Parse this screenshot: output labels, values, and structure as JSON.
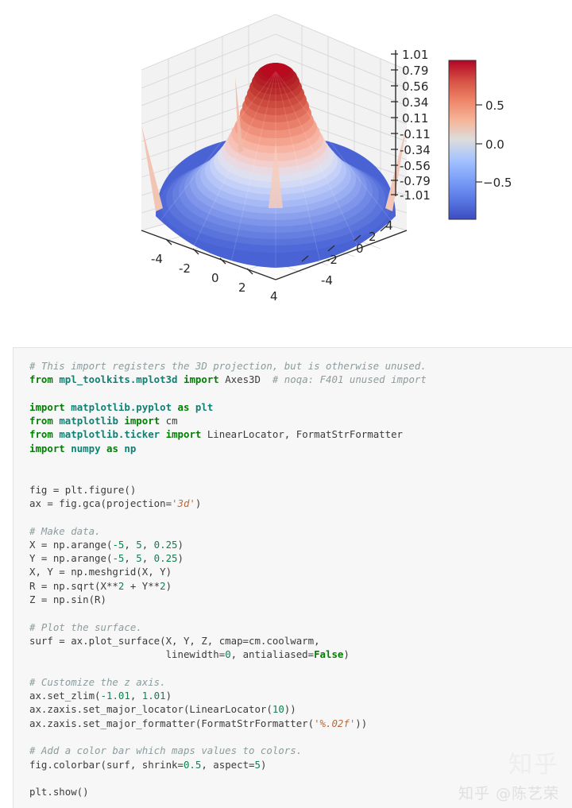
{
  "figure": {
    "plot_type": "surface3d",
    "colormap": "coolwarm",
    "z_axis": {
      "ticks": [
        "1.01",
        "0.79",
        "0.56",
        "0.34",
        "0.11",
        "-0.11",
        "-0.34",
        "-0.56",
        "-0.79",
        "-1.01"
      ],
      "lim": [
        -1.01,
        1.01
      ],
      "locator": "LinearLocator(10)",
      "formatter": "%.02f"
    },
    "x_axis": {
      "ticks": [
        "-4",
        "-2",
        "0",
        "2",
        "4"
      ],
      "lim": [
        -5,
        5
      ]
    },
    "y_axis": {
      "ticks": [
        "4",
        "2",
        "0",
        "-2",
        "-4"
      ],
      "lim": [
        -5,
        5
      ]
    },
    "colorbar": {
      "ticks": [
        "0.5",
        "0.0",
        "−0.5"
      ],
      "shrink": 0.5,
      "aspect": 5,
      "vmin": -1.0,
      "vmax": 1.0
    },
    "colors": {
      "cmap_low": "#3b4cc0",
      "cmap_mid": "#dddddd",
      "cmap_high": "#b40426",
      "pane": "#f2f2f2",
      "grid": "#d0d0d0",
      "axis": "#2b2b2b"
    }
  },
  "chart_data": {
    "type": "surface",
    "title": "",
    "xlabel": "",
    "ylabel": "",
    "zlabel": "",
    "function": "Z = sin(sqrt(X**2 + Y**2))",
    "x": {
      "start": -5,
      "stop": 5,
      "step": 0.25,
      "ticks": [
        -4,
        -2,
        0,
        2,
        4
      ]
    },
    "y": {
      "start": -5,
      "stop": 5,
      "step": 0.25,
      "ticks": [
        4,
        2,
        0,
        -2,
        -4
      ]
    },
    "z": {
      "min": -1.0,
      "max": 1.0,
      "lim": [
        -1.01,
        1.01
      ],
      "ticks": [
        1.01,
        0.79,
        0.56,
        0.34,
        0.11,
        -0.11,
        -0.34,
        -0.56,
        -0.79,
        -1.01
      ]
    },
    "colorbar_ticks": [
      0.5,
      0.0,
      -0.5
    ],
    "colormap": "coolwarm",
    "grid": true,
    "legend": "none"
  },
  "code": {
    "language": "python",
    "lines": [
      [
        {
          "t": "# This import registers the 3D projection, but is otherwise unused.",
          "c": "cm"
        }
      ],
      [
        {
          "t": "from",
          "c": "kw"
        },
        {
          "t": " ",
          "c": "pl"
        },
        {
          "t": "mpl_toolkits.mplot3d",
          "c": "nm"
        },
        {
          "t": " ",
          "c": "pl"
        },
        {
          "t": "import",
          "c": "kw"
        },
        {
          "t": " Axes3D  ",
          "c": "pl"
        },
        {
          "t": "# noqa: F401 unused import",
          "c": "cm"
        }
      ],
      [],
      [
        {
          "t": "import",
          "c": "kw"
        },
        {
          "t": " ",
          "c": "pl"
        },
        {
          "t": "matplotlib.pyplot",
          "c": "nm"
        },
        {
          "t": " ",
          "c": "pl"
        },
        {
          "t": "as",
          "c": "kw"
        },
        {
          "t": " ",
          "c": "pl"
        },
        {
          "t": "plt",
          "c": "nm"
        }
      ],
      [
        {
          "t": "from",
          "c": "kw"
        },
        {
          "t": " ",
          "c": "pl"
        },
        {
          "t": "matplotlib",
          "c": "nm"
        },
        {
          "t": " ",
          "c": "pl"
        },
        {
          "t": "import",
          "c": "kw"
        },
        {
          "t": " cm",
          "c": "pl"
        }
      ],
      [
        {
          "t": "from",
          "c": "kw"
        },
        {
          "t": " ",
          "c": "pl"
        },
        {
          "t": "matplotlib.ticker",
          "c": "nm"
        },
        {
          "t": " ",
          "c": "pl"
        },
        {
          "t": "import",
          "c": "kw"
        },
        {
          "t": " LinearLocator, FormatStrFormatter",
          "c": "pl"
        }
      ],
      [
        {
          "t": "import",
          "c": "kw"
        },
        {
          "t": " ",
          "c": "pl"
        },
        {
          "t": "numpy",
          "c": "nm"
        },
        {
          "t": " ",
          "c": "pl"
        },
        {
          "t": "as",
          "c": "kw"
        },
        {
          "t": " ",
          "c": "pl"
        },
        {
          "t": "np",
          "c": "nm"
        }
      ],
      [],
      [],
      [
        {
          "t": "fig = plt.figure()",
          "c": "pl"
        }
      ],
      [
        {
          "t": "ax = fig.gca(projection=",
          "c": "pl"
        },
        {
          "t": "'3d'",
          "c": "str"
        },
        {
          "t": ")",
          "c": "pl"
        }
      ],
      [],
      [
        {
          "t": "# Make data.",
          "c": "cm"
        }
      ],
      [
        {
          "t": "X = np.arange(",
          "c": "pl"
        },
        {
          "t": "-5",
          "c": "num"
        },
        {
          "t": ", ",
          "c": "pl"
        },
        {
          "t": "5",
          "c": "num"
        },
        {
          "t": ", ",
          "c": "pl"
        },
        {
          "t": "0.25",
          "c": "num"
        },
        {
          "t": ")",
          "c": "pl"
        }
      ],
      [
        {
          "t": "Y = np.arange(",
          "c": "pl"
        },
        {
          "t": "-5",
          "c": "num"
        },
        {
          "t": ", ",
          "c": "pl"
        },
        {
          "t": "5",
          "c": "num"
        },
        {
          "t": ", ",
          "c": "pl"
        },
        {
          "t": "0.25",
          "c": "num"
        },
        {
          "t": ")",
          "c": "pl"
        }
      ],
      [
        {
          "t": "X, Y = np.meshgrid(X, Y)",
          "c": "pl"
        }
      ],
      [
        {
          "t": "R = np.sqrt(X**",
          "c": "pl"
        },
        {
          "t": "2",
          "c": "num"
        },
        {
          "t": " + Y**",
          "c": "pl"
        },
        {
          "t": "2",
          "c": "num"
        },
        {
          "t": ")",
          "c": "pl"
        }
      ],
      [
        {
          "t": "Z = np.sin(R)",
          "c": "pl"
        }
      ],
      [],
      [
        {
          "t": "# Plot the surface.",
          "c": "cm"
        }
      ],
      [
        {
          "t": "surf = ax.plot_surface(X, Y, Z, cmap=cm.coolwarm,",
          "c": "pl"
        }
      ],
      [
        {
          "t": "                       linewidth=",
          "c": "pl"
        },
        {
          "t": "0",
          "c": "num"
        },
        {
          "t": ", antialiased=",
          "c": "pl"
        },
        {
          "t": "False",
          "c": "kw"
        },
        {
          "t": ")",
          "c": "pl"
        }
      ],
      [],
      [
        {
          "t": "# Customize the z axis.",
          "c": "cm"
        }
      ],
      [
        {
          "t": "ax.set_zlim(",
          "c": "pl"
        },
        {
          "t": "-1.01",
          "c": "num"
        },
        {
          "t": ", ",
          "c": "pl"
        },
        {
          "t": "1.01",
          "c": "num"
        },
        {
          "t": ")",
          "c": "pl"
        }
      ],
      [
        {
          "t": "ax.zaxis.set_major_locator(LinearLocator(",
          "c": "pl"
        },
        {
          "t": "10",
          "c": "num"
        },
        {
          "t": "))",
          "c": "pl"
        }
      ],
      [
        {
          "t": "ax.zaxis.set_major_formatter(FormatStrFormatter(",
          "c": "pl"
        },
        {
          "t": "'%.02f'",
          "c": "str"
        },
        {
          "t": "))",
          "c": "pl"
        }
      ],
      [],
      [
        {
          "t": "# Add a color bar which maps values to colors.",
          "c": "cm"
        }
      ],
      [
        {
          "t": "fig.colorbar(surf, shrink=",
          "c": "pl"
        },
        {
          "t": "0.5",
          "c": "num"
        },
        {
          "t": ", aspect=",
          "c": "pl"
        },
        {
          "t": "5",
          "c": "num"
        },
        {
          "t": ")",
          "c": "pl"
        }
      ],
      [],
      [
        {
          "t": "plt.show()",
          "c": "pl"
        }
      ]
    ]
  },
  "watermark": {
    "logo": "知乎",
    "bottom": "知乎 @陈艺荣"
  }
}
